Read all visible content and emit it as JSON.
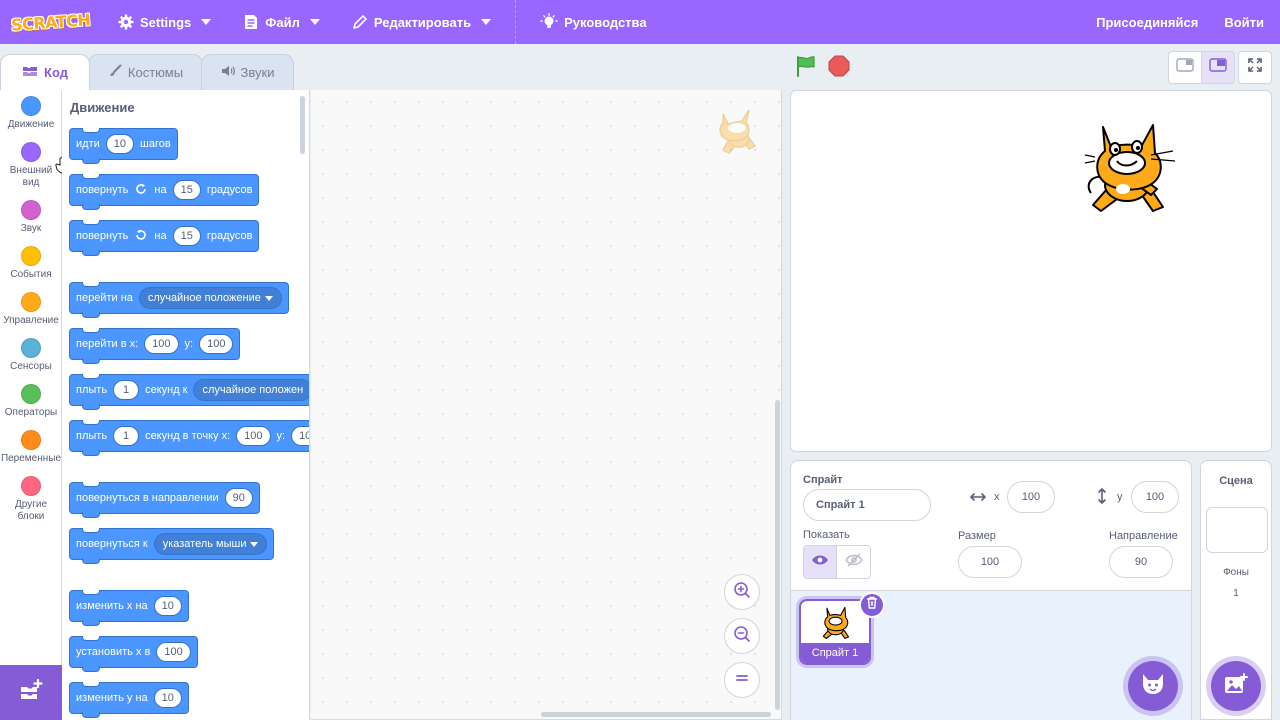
{
  "menubar": {
    "logo": "SCRATCH",
    "settings": "Settings",
    "file": "Файл",
    "edit": "Редактировать",
    "tutorials": "Руководства",
    "join": "Присоединяйся",
    "signin": "Войти"
  },
  "tabs": {
    "code": "Код",
    "costumes": "Костюмы",
    "sounds": "Звуки"
  },
  "categories": [
    {
      "label": "Движение",
      "color": "#4c97ff"
    },
    {
      "label": "Внешний вид",
      "color": "#9966ff"
    },
    {
      "label": "Звук",
      "color": "#cf63cf"
    },
    {
      "label": "События",
      "color": "#ffbf00"
    },
    {
      "label": "Управление",
      "color": "#ffab19"
    },
    {
      "label": "Сенсоры",
      "color": "#5cb1d6"
    },
    {
      "label": "Операторы",
      "color": "#59c059"
    },
    {
      "label": "Переменные",
      "color": "#ff8c1a"
    },
    {
      "label": "Другие блоки",
      "color": "#ff6680"
    }
  ],
  "palette": {
    "title": "Движение",
    "blocks": {
      "move": {
        "t1": "идти",
        "v1": "10",
        "t2": "шагов"
      },
      "turn_right": {
        "t1": "повернуть",
        "t2": "на",
        "v1": "15",
        "t3": "градусов"
      },
      "turn_left": {
        "t1": "повернуть",
        "t2": "на",
        "v1": "15",
        "t3": "градусов"
      },
      "goto": {
        "t1": "перейти на",
        "dd": "случайное положение"
      },
      "goto_xy": {
        "t1": "перейти в x:",
        "v1": "100",
        "t2": "y:",
        "v2": "100"
      },
      "glide": {
        "t1": "плыть",
        "v1": "1",
        "t2": "секунд к",
        "dd": "случайное положен"
      },
      "glide_xy": {
        "t1": "плыть",
        "v1": "1",
        "t2": "секунд в точку x:",
        "v2": "100",
        "t3": "y:",
        "v3": "10"
      },
      "point_dir": {
        "t1": "повернуться в направлении",
        "v1": "90"
      },
      "point_towards": {
        "t1": "повернуться к",
        "dd": "указатель мыши"
      },
      "change_x": {
        "t1": "изменить х на",
        "v1": "10"
      },
      "set_x": {
        "t1": "установить х в",
        "v1": "100"
      },
      "change_y": {
        "t1": "изменить у на",
        "v1": "10"
      }
    }
  },
  "sprite_info": {
    "sprite_label": "Спрайт",
    "sprite_name": "Спрайт 1",
    "x_label": "x",
    "x_value": "100",
    "y_label": "y",
    "y_value": "100",
    "show_label": "Показать",
    "size_label": "Размер",
    "size_value": "100",
    "direction_label": "Направление",
    "direction_value": "90"
  },
  "sprite_list": {
    "sprites": [
      "Спрайт 1"
    ]
  },
  "stage_pane": {
    "title": "Сцена",
    "backdrops_label": "Фоны",
    "backdrops_count": "1"
  },
  "colors": {
    "menu": "#9966ff",
    "accent": "#855cd6",
    "motion": "#4c97ff"
  }
}
